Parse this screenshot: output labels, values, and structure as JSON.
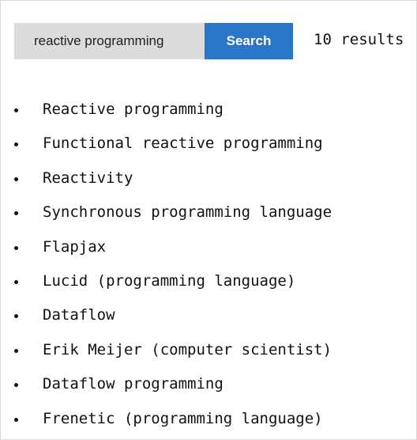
{
  "search": {
    "query": "reactive programming",
    "button_label": "Search",
    "result_count": "10 results"
  },
  "results": [
    "Reactive programming",
    "Functional reactive programming",
    "Reactivity",
    "Synchronous programming language",
    "Flapjax",
    "Lucid (programming language)",
    "Dataflow",
    "Erik Meijer (computer scientist)",
    "Dataflow programming",
    "Frenetic (programming language)"
  ]
}
